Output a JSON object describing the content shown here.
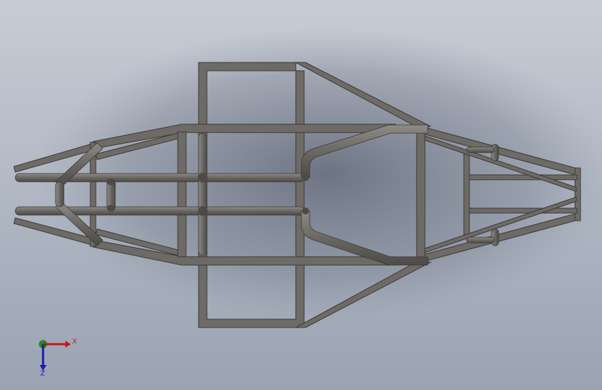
{
  "viewport": {
    "background_top": "#c7ccd5",
    "background_bottom": "#9aa3b2"
  },
  "model": {
    "frame_color": "#6e6a66",
    "frame_edge_color": "#3a3836",
    "tube_color": "#6b6763",
    "tube_highlight": "#8e8a86"
  },
  "triad": {
    "x_label": "X",
    "z_label": "Z",
    "x_color": "#c01818",
    "y_color": "#1f8a1f",
    "z_color": "#1a1aa8"
  }
}
